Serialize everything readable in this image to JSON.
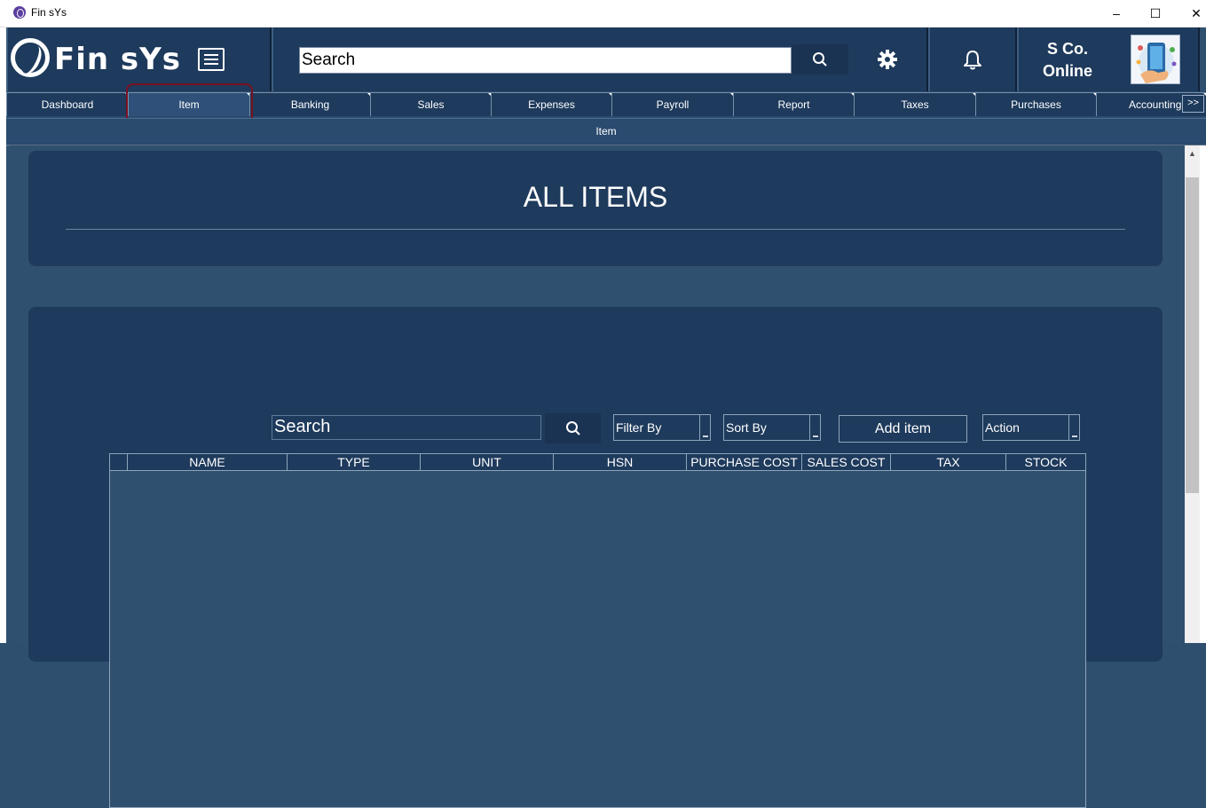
{
  "window": {
    "title": "Fin sYs",
    "minimize": "–",
    "maximize": "☐",
    "close": "✕"
  },
  "header": {
    "logo_text": "Fin sYs",
    "menu_icon": "hamburger-icon",
    "search_placeholder": "Search",
    "search_icon": "search-icon",
    "settings_icon": "gear-icon",
    "notifications_icon": "bell-icon",
    "company_line1": "S Co.",
    "company_line2": "Online"
  },
  "nav": {
    "tabs": [
      {
        "label": "Dashboard"
      },
      {
        "label": "Item"
      },
      {
        "label": "Banking"
      },
      {
        "label": "Sales"
      },
      {
        "label": "Expenses"
      },
      {
        "label": "Payroll"
      },
      {
        "label": "Report"
      },
      {
        "label": "Taxes"
      },
      {
        "label": "Purchases"
      },
      {
        "label": "Accounting"
      }
    ],
    "active_tab": "Item",
    "more_label": ">>"
  },
  "breadcrumb": {
    "label": "Item"
  },
  "main": {
    "heading": "ALL ITEMS",
    "toolbar": {
      "search_placeholder": "Search",
      "filter_label": "Filter By",
      "sort_label": "Sort By",
      "add_label": "Add item",
      "action_label": "Action"
    },
    "table": {
      "columns": [
        "NAME",
        "TYPE",
        "UNIT",
        "HSN",
        "PURCHASE COST",
        "SALES COST",
        "TAX",
        "STOCK"
      ],
      "rows": []
    }
  },
  "colors": {
    "panel": "#1e3a5c",
    "background": "#30506f",
    "highlight_border": "#7a1020"
  }
}
